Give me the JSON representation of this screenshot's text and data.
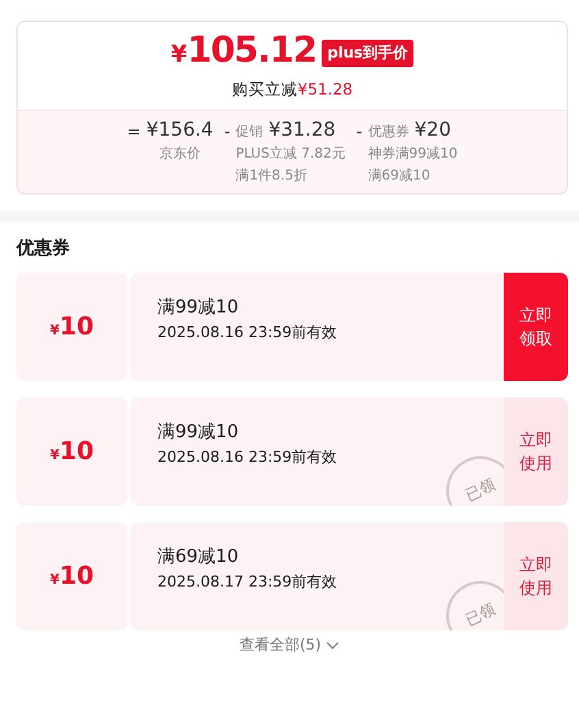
{
  "price_card": {
    "currency": "¥",
    "amount": "105.12",
    "badge": "plus到手价",
    "saving_label": "购买立减",
    "saving_amount": "¥51.28",
    "breakdown": [
      {
        "operator": "=",
        "amount": "¥156.4",
        "notes": [
          "京东价"
        ]
      },
      {
        "operator": "-",
        "label": "促销",
        "amount": "¥31.28",
        "notes": [
          "PLUS立减 7.82元",
          "满1件8.5折"
        ]
      },
      {
        "operator": "-",
        "label": "优惠券",
        "amount": "¥20",
        "notes": [
          "神券满99减10",
          "满69减10"
        ]
      }
    ]
  },
  "coupons_section": {
    "title": "优惠券",
    "coupons": [
      {
        "currency": "¥",
        "value": "10",
        "title": "满99减10",
        "validity": "2025.08.16 23:59前有效",
        "action": "立即领取",
        "claimed": false
      },
      {
        "currency": "¥",
        "value": "10",
        "title": "满99减10",
        "validity": "2025.08.16 23:59前有效",
        "action": "立即使用",
        "claimed": true,
        "stamp": "已领"
      },
      {
        "currency": "¥",
        "value": "10",
        "title": "满69减10",
        "validity": "2025.08.17 23:59前有效",
        "action": "立即使用",
        "claimed": true,
        "stamp": "已领"
      }
    ],
    "view_all": "查看全部(5)"
  }
}
